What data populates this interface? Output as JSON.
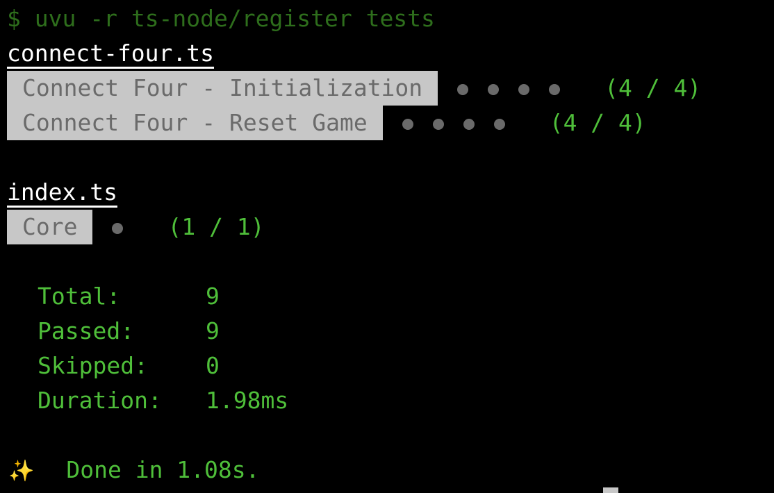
{
  "command": {
    "prompt_symbol": "$",
    "text": "uvu -r ts-node/register tests"
  },
  "files": [
    {
      "name": "connect-four.ts",
      "suites": [
        {
          "name": "Connect Four - Initialization",
          "dots": 4,
          "count": "(4 / 4)"
        },
        {
          "name": "Connect Four - Reset Game",
          "dots": 4,
          "count": "(4 / 4)"
        }
      ]
    },
    {
      "name": "index.ts",
      "suites": [
        {
          "name": "Core",
          "dots": 1,
          "count": "(1 / 1)"
        }
      ]
    }
  ],
  "summary": {
    "total_label": "Total:",
    "total_value": "9",
    "passed_label": "Passed:",
    "passed_value": "9",
    "skipped_label": "Skipped:",
    "skipped_value": "0",
    "duration_label": "Duration:",
    "duration_value": "1.98ms"
  },
  "done": {
    "icon": "sparkles-icon",
    "glyph": "✨",
    "text": "Done in 1.08s."
  },
  "colors": {
    "background": "#000000",
    "prompt": "#2e6e1c",
    "success": "#4fbf3a",
    "suite_bg": "#c7c7c7",
    "suite_text": "#6a6a6a"
  }
}
